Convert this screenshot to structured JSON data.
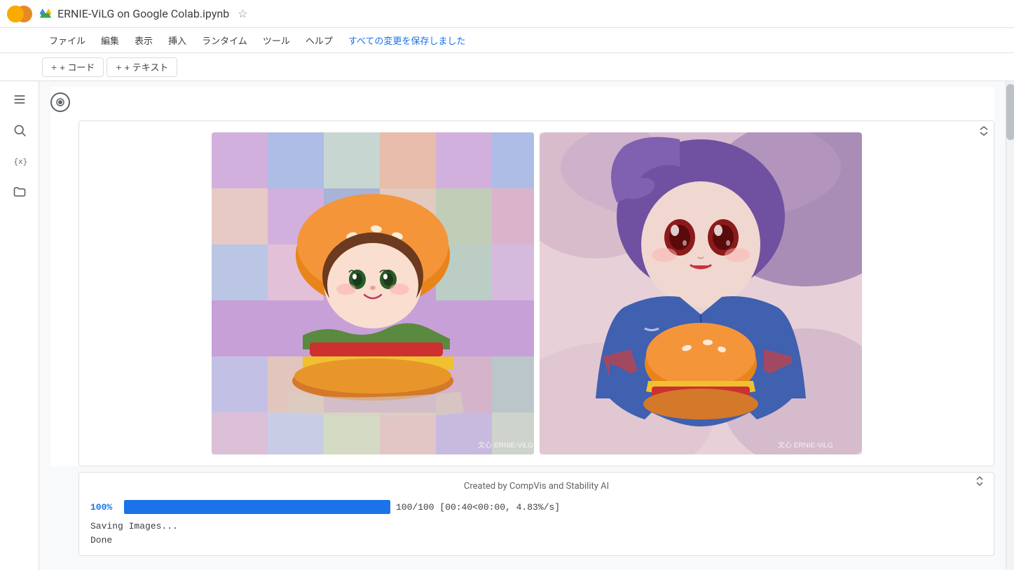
{
  "logo": {
    "text": "CO",
    "color": "#e8710a"
  },
  "header": {
    "drive_icon_title": "Google Drive",
    "notebook_title": "ERNIE-ViLG on Google Colab.ipynb",
    "star_icon": "☆",
    "save_status": "すべての変更を保存しました"
  },
  "menu": {
    "items": [
      {
        "label": "ファイル"
      },
      {
        "label": "編集"
      },
      {
        "label": "表示"
      },
      {
        "label": "挿入"
      },
      {
        "label": "ランタイム"
      },
      {
        "label": "ツール"
      },
      {
        "label": "ヘルプ"
      }
    ],
    "save_status": "すべての変更を保存しました"
  },
  "toolbar": {
    "add_code_label": "+ コード",
    "add_text_label": "+ テキスト"
  },
  "sidebar": {
    "icons": [
      {
        "name": "menu-icon",
        "symbol": "☰"
      },
      {
        "name": "search-icon",
        "symbol": "🔍"
      },
      {
        "name": "variable-icon",
        "symbol": "{x}"
      },
      {
        "name": "folder-icon",
        "symbol": "📁"
      }
    ]
  },
  "output": {
    "image1_watermark": "文心 ERNIE-ViLG",
    "image2_watermark": "文心 ERNIE-ViLG",
    "created_by": "Created by CompVis and Stability AI",
    "progress_percent": "100%",
    "progress_bar_width": "100",
    "progress_detail": "100/100 [00:40<00:00, 4.83%/s]",
    "saving_text": "Saving Images...",
    "done_text": "Done"
  }
}
